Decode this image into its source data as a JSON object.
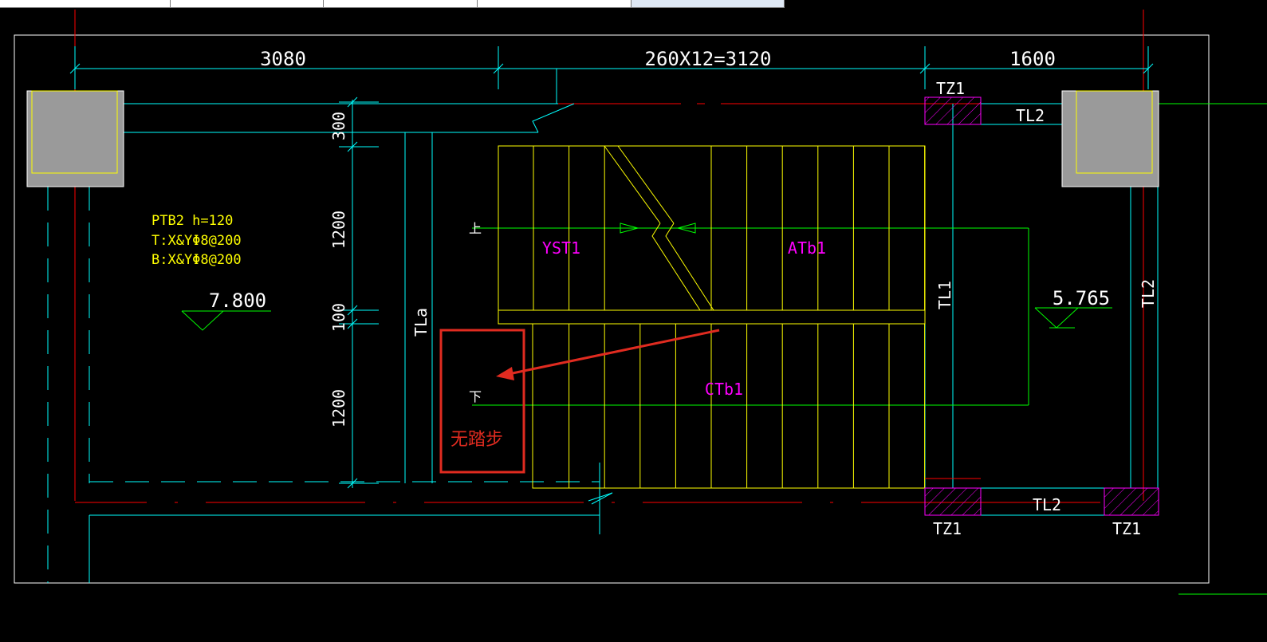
{
  "top_tabs": [
    "",
    "",
    "",
    "",
    "",
    ""
  ],
  "dimensions": {
    "top_left": "3080",
    "top_middle": "260X12=3120",
    "top_right": "1600",
    "left_300": "300",
    "left_1200_upper": "1200",
    "left_100": "100",
    "left_1200_lower": "1200"
  },
  "beam_labels": {
    "tz1_top": "TZ1",
    "tl2_top": "TL2",
    "tl1": "TL1",
    "tl2_right": "TL2",
    "tla": "TLa",
    "tl2_bottom": "TL2",
    "tz1_bottom_left": "TZ1",
    "tz1_bottom_right": "TZ1"
  },
  "slab_note": {
    "line1": "PTB2  h=120",
    "line2": "T:X&YΦ8@200",
    "line3": "B:X&YΦ8@200"
  },
  "elevations": {
    "left": "7.800",
    "right": "5.765"
  },
  "stair_labels": {
    "upper_left": "YST1",
    "upper_right": "ATb1",
    "lower": "CTb1",
    "up_mark": "上",
    "down_mark": "下"
  },
  "annotation": {
    "text": "无踏步",
    "color": "#e02b20"
  },
  "colors": {
    "background": "#000000",
    "cyan": "#00ffff",
    "yellow": "#ffff00",
    "red": "#ff0000",
    "green": "#00ff00",
    "magenta": "#ff00ff",
    "gray": "#a0a0a0",
    "white": "#ffffff"
  }
}
